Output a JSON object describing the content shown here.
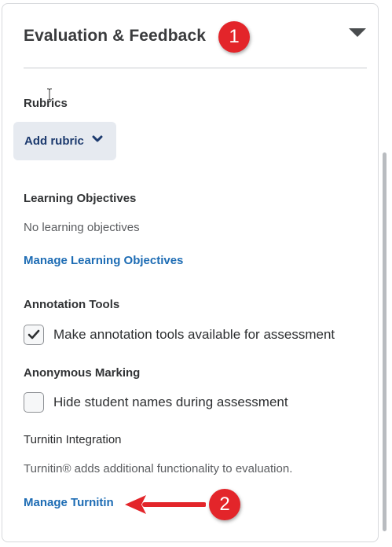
{
  "panel": {
    "title": "Evaluation & Feedback",
    "caret_icon": "caret-down-icon"
  },
  "rubrics": {
    "label": "Rubrics",
    "add_button_label": "Add rubric",
    "chevron_icon": "chevron-down-icon"
  },
  "learning_objectives": {
    "label": "Learning Objectives",
    "empty_text": "No learning objectives",
    "manage_link": "Manage Learning Objectives"
  },
  "annotation_tools": {
    "label": "Annotation Tools",
    "checkbox_label": "Make annotation tools available for assessment",
    "checked": true
  },
  "anonymous_marking": {
    "label": "Anonymous Marking",
    "checkbox_label": "Hide student names during assessment",
    "checked": false
  },
  "turnitin": {
    "label": "Turnitin Integration",
    "description": "Turnitin® adds additional functionality to evaluation.",
    "manage_link": "Manage Turnitin"
  },
  "annotations": {
    "badge_1": "1",
    "badge_2": "2",
    "badge_color": "#e3252a"
  },
  "colors": {
    "link": "#1d6cb4",
    "button_bg": "#e6eaf0",
    "button_text": "#1c3a6e"
  }
}
